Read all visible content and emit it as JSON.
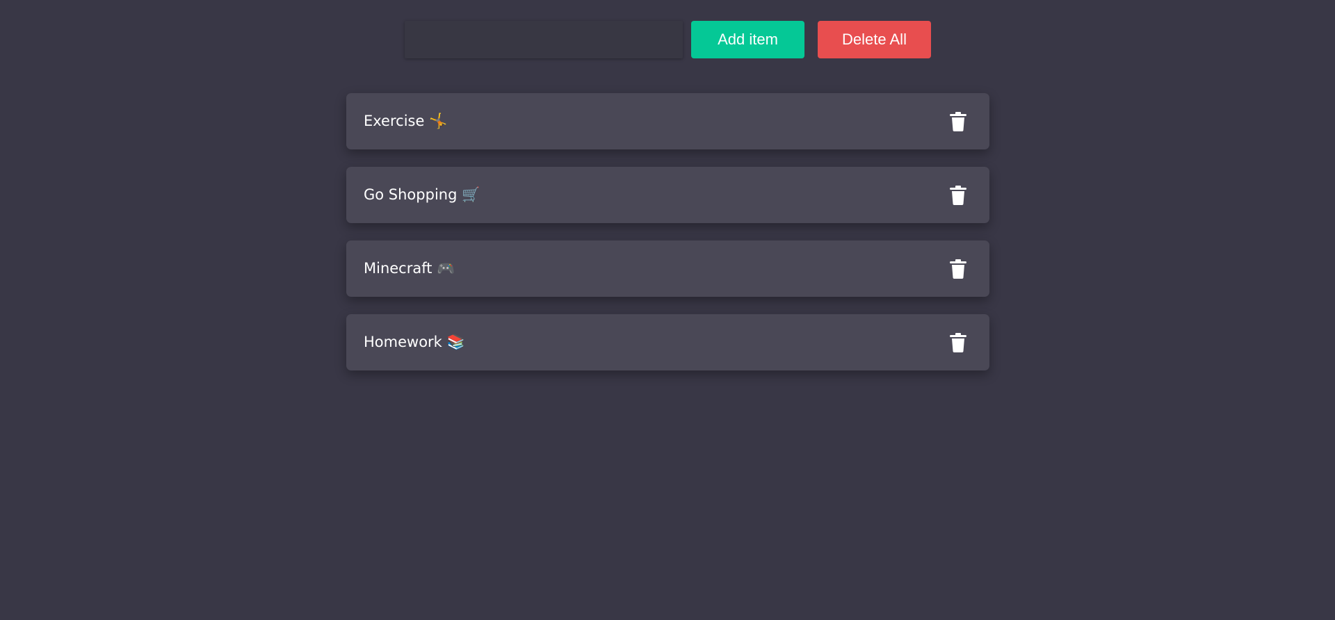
{
  "input": {
    "value": "",
    "placeholder": ""
  },
  "buttons": {
    "add_label": "Add item",
    "delete_all_label": "Delete All"
  },
  "colors": {
    "background": "#393746",
    "card": "#4a4856",
    "add_button": "#05c896",
    "delete_button": "#e84e4f"
  },
  "items": [
    {
      "label": "Exercise 🤸",
      "action_icon": "trash-icon"
    },
    {
      "label": "Go Shopping 🛒",
      "action_icon": "trash-icon"
    },
    {
      "label": "Minecraft 🎮",
      "action_icon": "trash-icon"
    },
    {
      "label": "Homework 📚",
      "action_icon": "trash-icon"
    }
  ]
}
